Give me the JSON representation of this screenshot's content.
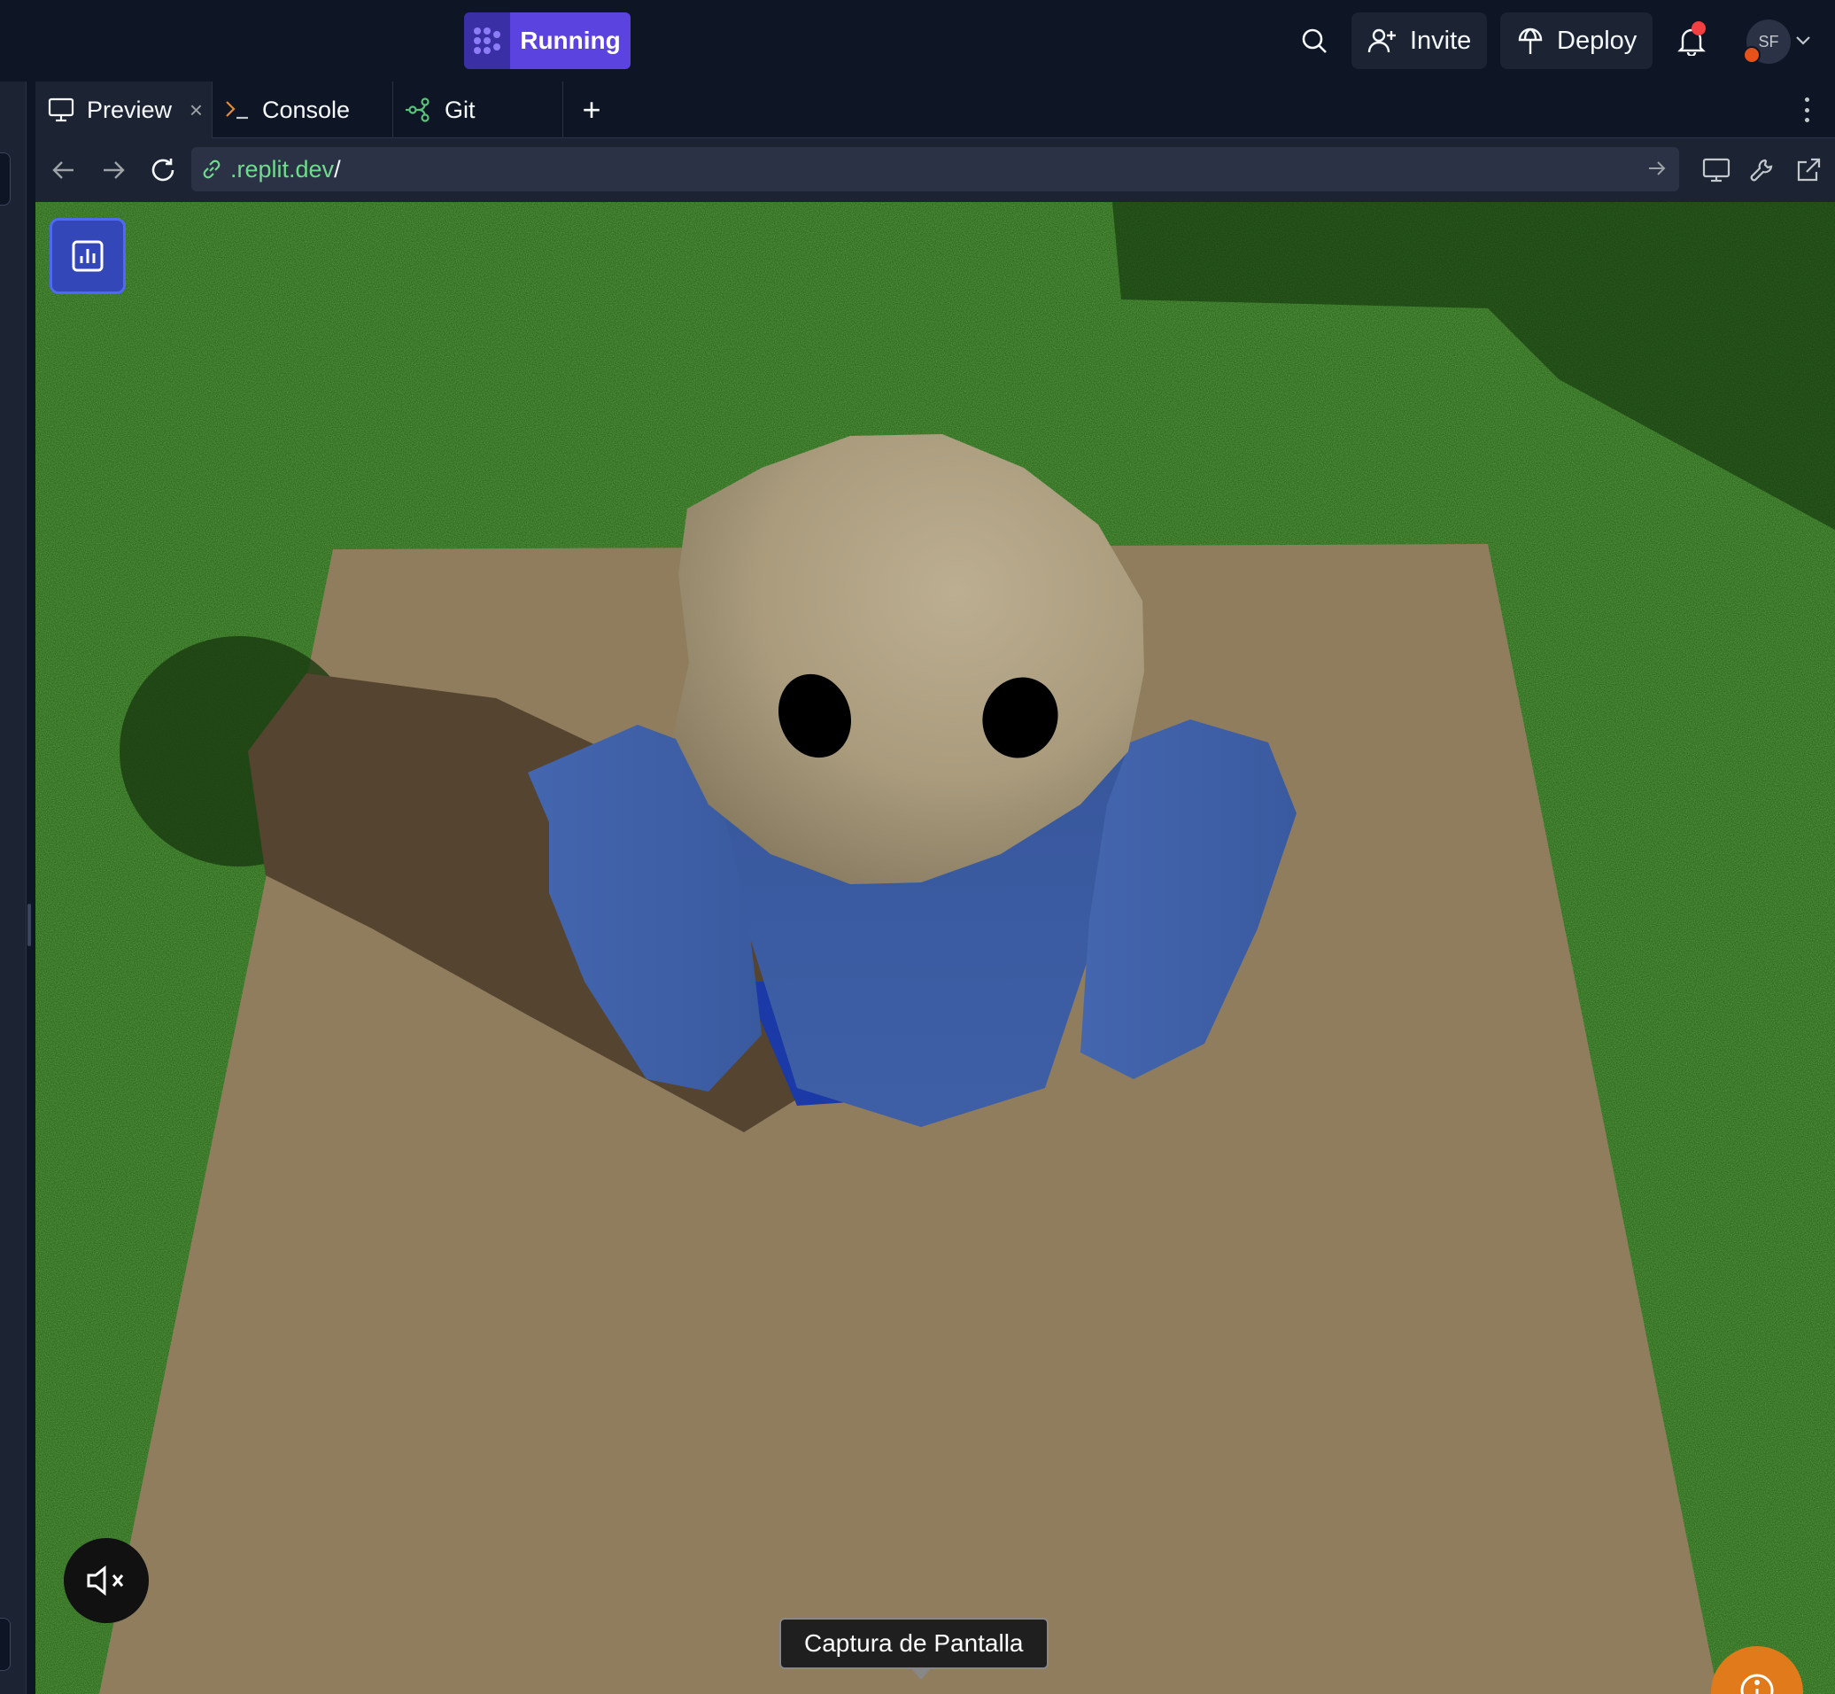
{
  "topbar": {
    "run_label": "Running",
    "invite_label": "Invite",
    "deploy_label": "Deploy",
    "avatar_initials": "SF"
  },
  "tabs": [
    {
      "label": "Preview",
      "icon": "monitor-icon",
      "active": true
    },
    {
      "label": "Console",
      "icon": "terminal-icon",
      "active": false
    },
    {
      "label": "Git",
      "icon": "git-icon",
      "active": false
    }
  ],
  "address": {
    "domain": ".replit.dev",
    "path": "/"
  },
  "game": {
    "tooltip": "Captura de Pantalla",
    "stats_icon": "bar-chart-icon",
    "mute_icon": "speaker-muted-icon",
    "info_icon": "info-icon"
  },
  "colors": {
    "run_accent": "#5b43e0",
    "grass": "#2f6a1d",
    "ground": "#8f7d5e",
    "shirt": "#3d5fa8",
    "skin": "#b5a88a"
  }
}
